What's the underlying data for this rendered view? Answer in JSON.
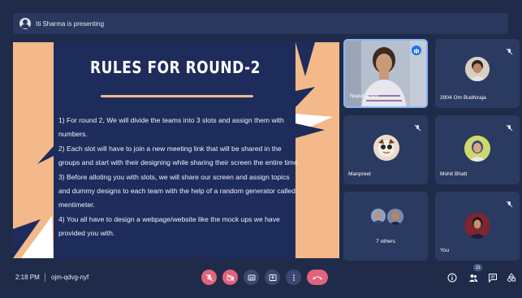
{
  "presenting_banner": {
    "text": "Iti Sharma is presenting"
  },
  "slide": {
    "title": "RULES FOR ROUND-2",
    "paragraphs": [
      "1) For round 2, We will divide the teams into 3 slots and assign them with numbers.",
      "2) Each slot will have to join a new meeting link that will be shared in the groups and start with their designing while sharing their screen the entire time.",
      "3) Before alloting you with slots, we will share our screen and assign topics and dummy designs to each team with the help of a random generator called mentimeter.",
      "4) You all have to design a webpage/website like the mock ups we have provided you with."
    ]
  },
  "participants": [
    {
      "name": "Nupur Joshi",
      "status": "speaking"
    },
    {
      "name": "2904 Om Budhiraja",
      "status": "muted"
    },
    {
      "name": "Manpreet",
      "status": "muted"
    },
    {
      "name": "Mohit Bhatt",
      "status": "muted"
    },
    {
      "name": "7 others",
      "status": ""
    },
    {
      "name": "You",
      "status": "muted"
    }
  ],
  "meeting": {
    "time": "2:18 PM",
    "code": "ojm-qdvg-nyf"
  },
  "people_count": "13",
  "colors": {
    "background": "#1f2b49",
    "tile": "#2b3a61",
    "danger": "#e2637a",
    "slide_accent": "#f3b98a",
    "slide_bg": "#1e2c5c"
  },
  "icons": [
    "presenter-icon",
    "mic-off-icon",
    "camera-off-icon",
    "captions-icon",
    "present-icon",
    "more-icon",
    "end-call-icon",
    "info-icon",
    "people-icon",
    "chat-icon",
    "activities-icon"
  ]
}
